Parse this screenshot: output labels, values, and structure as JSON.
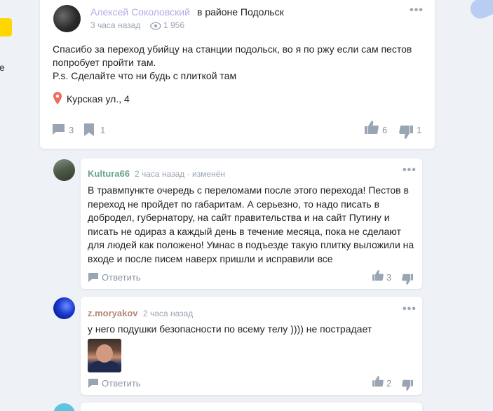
{
  "left_edge": {
    "stray_letter": "е"
  },
  "post": {
    "author": "Алексей Соколовский",
    "location_prefix": "в районе Подольск",
    "time": "3 часа назад",
    "views": "1 956",
    "text_lines": [
      "Спасибо за переход убийцу на станции подольск, во я по ржу если сам пестов",
      "попробует пройти там.",
      "P.s. Сделайте что ни будь с плиткой там"
    ],
    "address": "Курская ул., 4",
    "comments_count": "3",
    "bookmarks_count": "1",
    "likes": "6",
    "dislikes": "1",
    "menu": "•••"
  },
  "comments": [
    {
      "author": "Kultura66",
      "meta": "2 часа назад · изменён",
      "text_lines": [
        "В травмпункте очередь с переломами после этого перехода! Пестов в",
        "переход не пройдет по габаритам. А серьезно, то надо писать в",
        "добродел, губернатору, на сайт правительства и на сайт Путину и",
        "писать не одираз а каждый день в течение месяца, пока не сделают",
        "для людей как положено! Умнас в подъезде такую плитку выложили на",
        "входе и после писем наверх пришли и исправили все"
      ],
      "reply": "Ответить",
      "likes": "3",
      "menu": "•••"
    },
    {
      "author": "z.moryakov",
      "meta": "2 часа назад",
      "text_lines": [
        "у него подушки безопасности по всему телу )))) не пострадает"
      ],
      "reply": "Ответить",
      "likes": "2",
      "menu": "•••"
    }
  ],
  "colors": {
    "background": "#eef1f6",
    "author_post": "#b9a8e8",
    "author_green": "#6aa58a",
    "author_brown": "#b2887a",
    "muted": "#9aa5b4",
    "pin": "#f06a5a",
    "yellow": "#ffd600"
  },
  "icons": [
    "eye-icon",
    "location-pin-icon",
    "comment-icon",
    "bookmark-icon",
    "thumbs-up-icon",
    "thumbs-down-icon",
    "more-dots-icon"
  ]
}
